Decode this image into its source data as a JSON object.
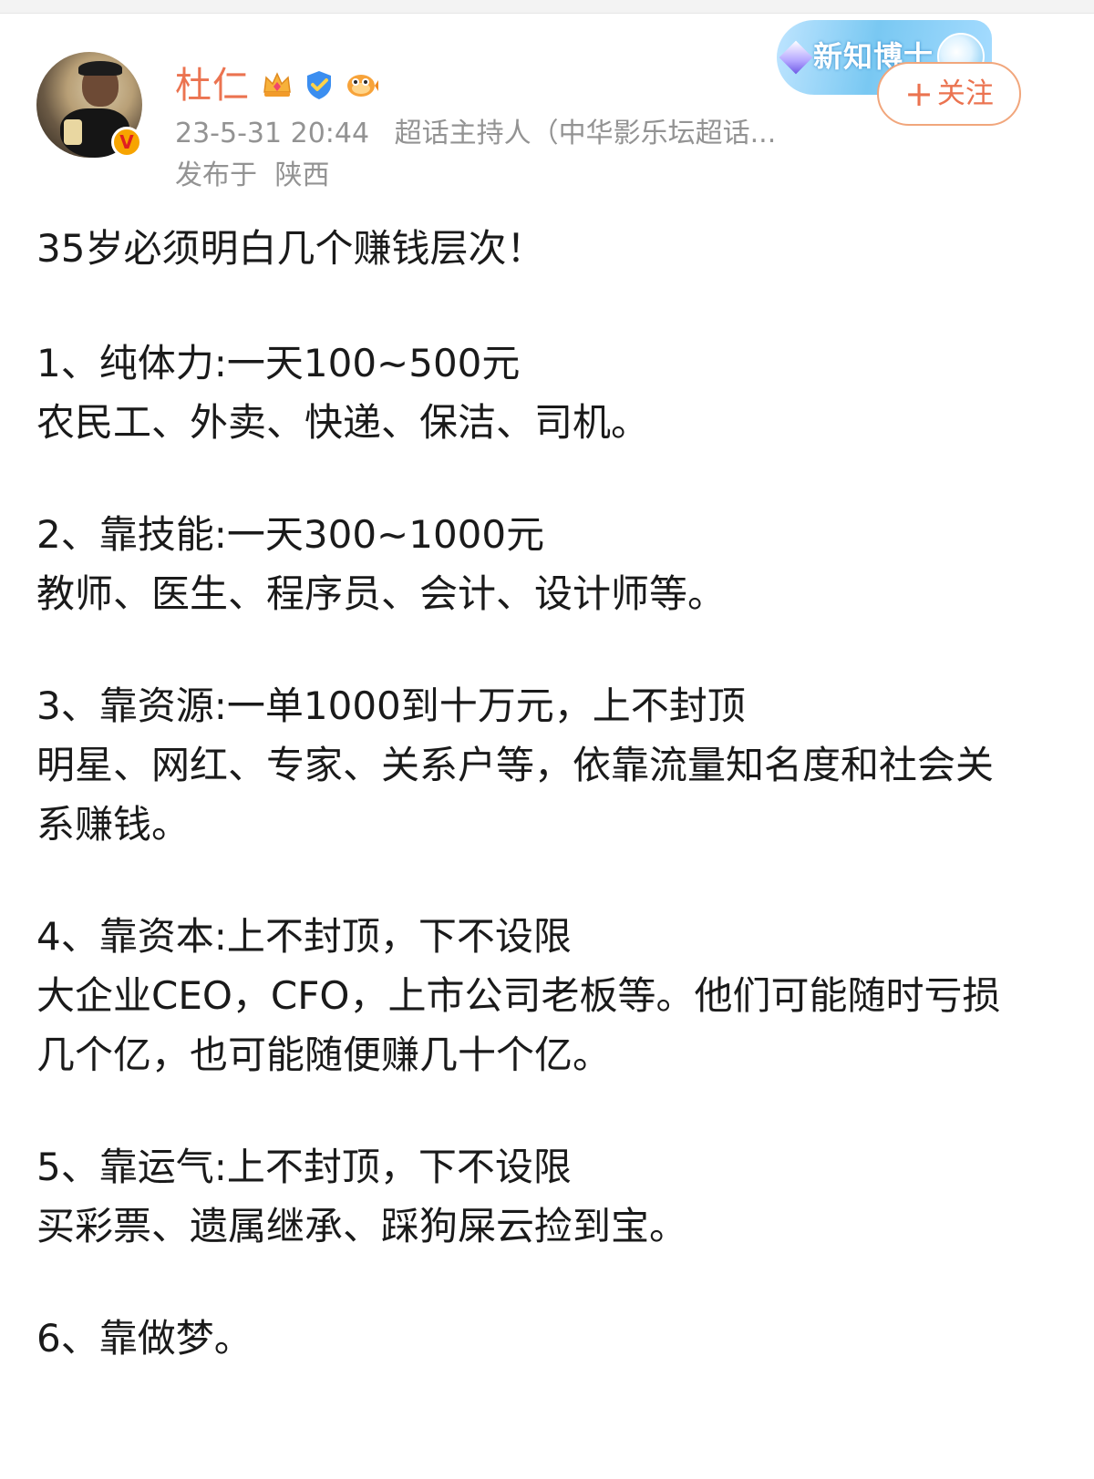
{
  "author": {
    "name": "杜仁",
    "badges": [
      "crown-badge",
      "shield-badge",
      "fish-badge"
    ],
    "verified": "V",
    "timestamp": "23-5-31 20:44",
    "role": "超话主持人（中华影乐坛超话...",
    "location_prefix": "发布于",
    "location": "陕西",
    "honor_badge": "新知博士"
  },
  "follow_button": {
    "plus": "+",
    "label": "关注"
  },
  "post": {
    "title": "35岁必须明白几个赚钱层次！",
    "items": [
      {
        "heading": "1、纯体力:一天100~500元",
        "detail": "农民工、外卖、快递、保洁、司机。"
      },
      {
        "heading": "2、靠技能:一天300~1000元",
        "detail": "教师、医生、程序员、会计、设计师等。"
      },
      {
        "heading": "3、靠资源:一单1000到十万元，上不封顶",
        "detail": "明星、网红、专家、关系户等，依靠流量知名度和社会关系赚钱。"
      },
      {
        "heading": "4、靠资本:上不封顶，下不设限",
        "detail": "大企业CEO，CFO，上市公司老板等。他们可能随时亏损几个亿，也可能随便赚几十个亿。"
      },
      {
        "heading": "5、靠运气:上不封顶，下不设限",
        "detail": "买彩票、遗属继承、踩狗屎云捡到宝。"
      },
      {
        "heading": "6、靠做梦。"
      }
    ]
  },
  "colors": {
    "username": "#eb7350",
    "meta": "#939393",
    "text": "#1a1a1a",
    "follow_border": "#f1a67c"
  }
}
